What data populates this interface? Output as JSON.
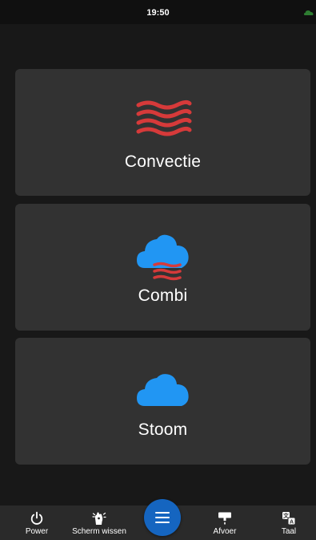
{
  "status_bar": {
    "time": "19:50",
    "indicator_icon": "cloud-status-icon",
    "indicator_color": "#2e7d32"
  },
  "modes": [
    {
      "label": "Convectie",
      "icon": "heat-waves-icon"
    },
    {
      "label": "Combi",
      "icon": "cloud-heat-icon"
    },
    {
      "label": "Stoom",
      "icon": "cloud-icon"
    }
  ],
  "colors": {
    "heat": "#d63a3a",
    "steam": "#2196f3",
    "card": "#323232",
    "fab": "#1565c0"
  },
  "bottom_nav": {
    "power": {
      "label": "Power",
      "icon": "power-icon"
    },
    "clean": {
      "label": "Scherm wissen",
      "icon": "hand-wipe-icon"
    },
    "menu": {
      "icon": "menu-icon"
    },
    "drain": {
      "label": "Afvoer",
      "icon": "drain-icon"
    },
    "language": {
      "label": "Taal",
      "icon": "translate-icon"
    }
  }
}
